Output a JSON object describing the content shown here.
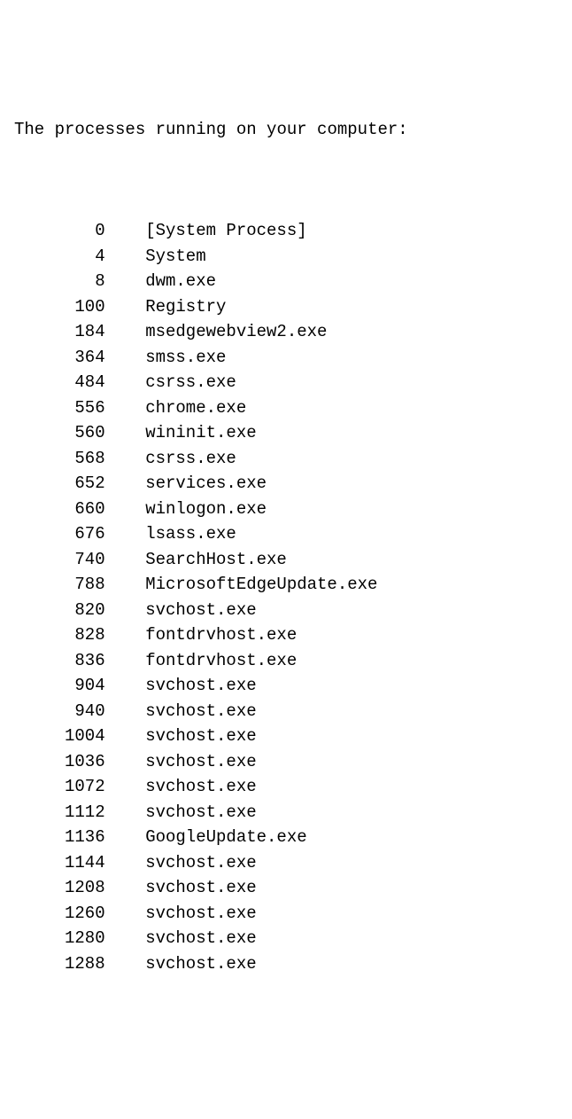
{
  "heading": "The processes running on your computer:",
  "processes": [
    {
      "pid": "0",
      "name": "[System Process]"
    },
    {
      "pid": "4",
      "name": "System"
    },
    {
      "pid": "8",
      "name": "dwm.exe"
    },
    {
      "pid": "100",
      "name": "Registry"
    },
    {
      "pid": "184",
      "name": "msedgewebview2.exe"
    },
    {
      "pid": "364",
      "name": "smss.exe"
    },
    {
      "pid": "484",
      "name": "csrss.exe"
    },
    {
      "pid": "556",
      "name": "chrome.exe"
    },
    {
      "pid": "560",
      "name": "wininit.exe"
    },
    {
      "pid": "568",
      "name": "csrss.exe"
    },
    {
      "pid": "652",
      "name": "services.exe"
    },
    {
      "pid": "660",
      "name": "winlogon.exe"
    },
    {
      "pid": "676",
      "name": "lsass.exe"
    },
    {
      "pid": "740",
      "name": "SearchHost.exe"
    },
    {
      "pid": "788",
      "name": "MicrosoftEdgeUpdate.exe"
    },
    {
      "pid": "820",
      "name": "svchost.exe"
    },
    {
      "pid": "828",
      "name": "fontdrvhost.exe"
    },
    {
      "pid": "836",
      "name": "fontdrvhost.exe"
    },
    {
      "pid": "904",
      "name": "svchost.exe"
    },
    {
      "pid": "940",
      "name": "svchost.exe"
    },
    {
      "pid": "1004",
      "name": "svchost.exe"
    },
    {
      "pid": "1036",
      "name": "svchost.exe"
    },
    {
      "pid": "1072",
      "name": "svchost.exe"
    },
    {
      "pid": "1112",
      "name": "svchost.exe"
    },
    {
      "pid": "1136",
      "name": "GoogleUpdate.exe"
    },
    {
      "pid": "1144",
      "name": "svchost.exe"
    },
    {
      "pid": "1208",
      "name": "svchost.exe"
    },
    {
      "pid": "1260",
      "name": "svchost.exe"
    },
    {
      "pid": "1280",
      "name": "svchost.exe"
    },
    {
      "pid": "1288",
      "name": "svchost.exe"
    }
  ]
}
